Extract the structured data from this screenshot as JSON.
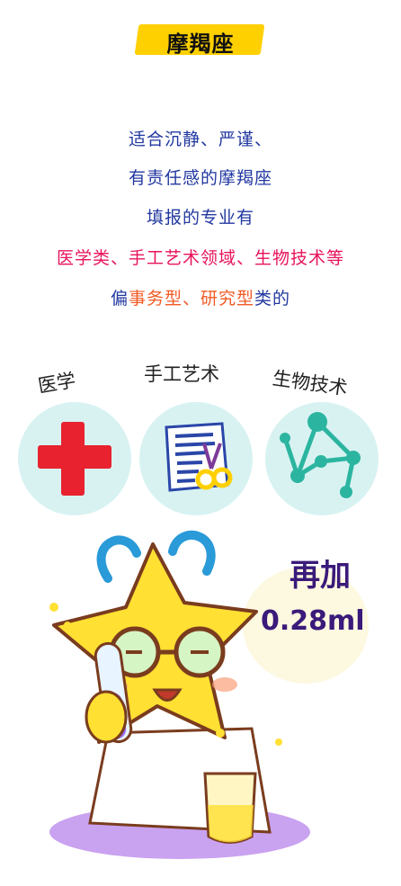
{
  "title": "摩羯座",
  "intro": {
    "line1": "适合沉静、严谨、",
    "line2": "有责任感的摩羯座",
    "line3": "填报的专业有",
    "line4": "医学类、手工艺术领域、生物技术等",
    "line5": {
      "a": "偏",
      "b": "事务型、研究型",
      "c": "类的"
    }
  },
  "categories": [
    {
      "label": "医学",
      "icon": "red-cross-icon"
    },
    {
      "label": "手工艺术",
      "icon": "paper-scissors-icon"
    },
    {
      "label": "生物技术",
      "icon": "molecule-icon"
    }
  ],
  "mascot_speech": {
    "line1": "再加",
    "line2": "0.28ml"
  },
  "colors": {
    "title_bar": "#ffd000",
    "blue_text": "#2238a0",
    "red_text": "#e8135a",
    "orange_text": "#f15a24",
    "circle_bg": "#d8f2f2",
    "mascot": "#ffe033"
  }
}
